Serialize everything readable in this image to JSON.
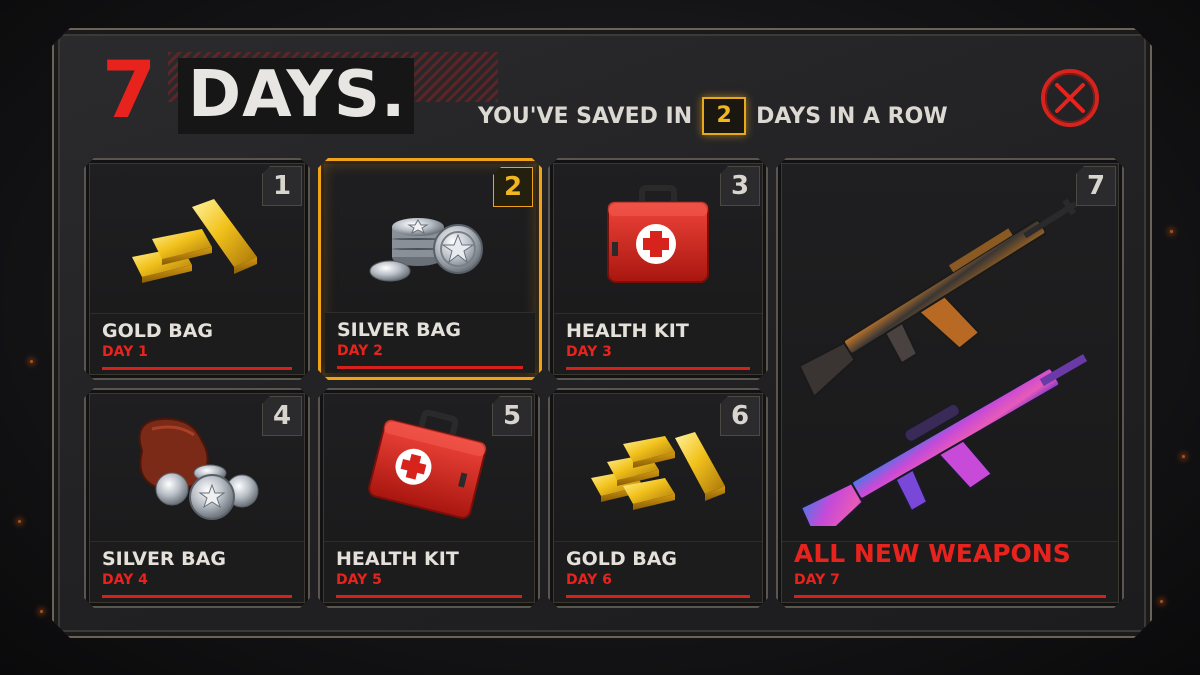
{
  "title": {
    "number": "7",
    "word": "DAYS."
  },
  "streak": {
    "prefix": "YOU'VE SAVED IN",
    "count": "2",
    "suffix": "DAYS IN A ROW"
  },
  "close": {
    "icon": "close-icon",
    "color": "#e8231d"
  },
  "colors": {
    "accent_red": "#e8231d",
    "highlight_gold": "#f0a21a",
    "panel_bg": "#222224"
  },
  "rewards": [
    {
      "number": "1",
      "name": "GOLD BAG",
      "day": "DAY 1",
      "icon": "gold-bars-icon",
      "active": false
    },
    {
      "number": "2",
      "name": "SILVER BAG",
      "day": "DAY 2",
      "icon": "silver-coins-icon",
      "active": true
    },
    {
      "number": "3",
      "name": "HEALTH KIT",
      "day": "DAY 3",
      "icon": "health-kit-icon",
      "active": false
    },
    {
      "number": "4",
      "name": "SILVER BAG",
      "day": "DAY 4",
      "icon": "silver-coin-sack-icon",
      "active": false
    },
    {
      "number": "5",
      "name": "HEALTH KIT",
      "day": "DAY 5",
      "icon": "health-kit-icon",
      "active": false
    },
    {
      "number": "6",
      "name": "GOLD BAG",
      "day": "DAY 6",
      "icon": "gold-bars-icon",
      "active": false
    },
    {
      "number": "7",
      "name": "ALL NEW WEAPONS",
      "day": "DAY 7",
      "icon": "rifles-icon",
      "active": false
    }
  ]
}
